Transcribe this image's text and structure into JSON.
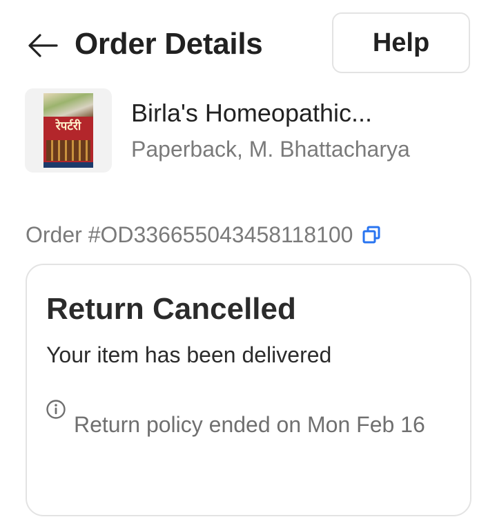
{
  "header": {
    "title": "Order Details",
    "help_label": "Help",
    "back_icon": "arrow-left-icon"
  },
  "product": {
    "name": "Birla's Homeopathic...",
    "meta": "Paperback, M. Bhattacharya",
    "cover_title": "रेपर्टरी"
  },
  "order": {
    "id_text": "Order #OD336655043458118100",
    "copy_icon": "copy-icon",
    "copy_icon_color": "#2874f0"
  },
  "status_card": {
    "title": "Return Cancelled",
    "subtitle": "Your item has been delivered",
    "policy_text": "Return policy ended on Mon Feb 16",
    "info_icon": "info-icon"
  }
}
